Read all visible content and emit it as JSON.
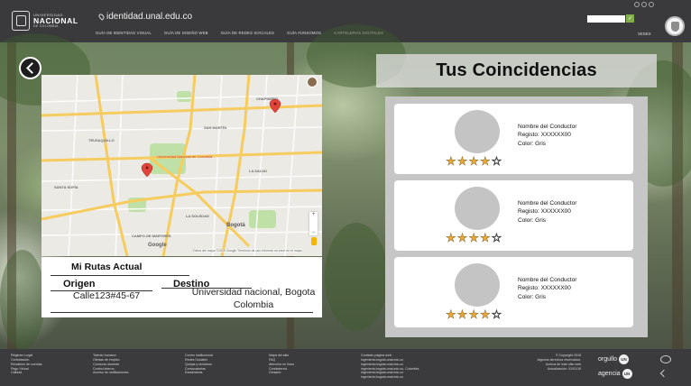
{
  "header": {
    "site_url": "identidad.unal.edu.co",
    "logo_small": "UNIVERSIDAD",
    "logo_big": "NACIONAL",
    "logo_sub": "DE COLOMBIA",
    "nav": [
      "GUÍA DE IDENTIDAD VISUAL",
      "GUÍA DE DISEÑO WEB",
      "GUÍA DE REDES SOCIALES",
      "GUÍA #UNSOMOS",
      "CARTELERAS DIGITALES"
    ],
    "sedes_label": "SEDES",
    "search_button_glyph": "✓"
  },
  "route": {
    "title": "Mi Rutas Actual",
    "origin_label": "Origen",
    "origin_value": "Calle123#45-67",
    "destination_label": "Destino",
    "destination_value": "Universidad nacional, Bogota Colombia"
  },
  "matches": {
    "title": "Tus Coincidencias",
    "drivers": [
      {
        "name": "Nombre del Conductor",
        "registro": "Registo: XXXXXX00",
        "color": "Color: Gris",
        "rating": 4,
        "max_rating": 5
      },
      {
        "name": "Nombre del Conductor",
        "registro": "Registo: XXXXXX00",
        "color": "Color: Gris",
        "rating": 4,
        "max_rating": 5
      },
      {
        "name": "Nombre del Conductor",
        "registro": "Registo: XXXXXX00",
        "color": "Color: Gris",
        "rating": 4,
        "max_rating": 5
      }
    ]
  },
  "map": {
    "place_label": "Universidad Nacional de Colombia",
    "city_label": "Bogotá",
    "google_label": "Google",
    "controls": [
      "+",
      "−"
    ],
    "footer_text": "Datos del mapa ©2019 Google  Términos de uso  Informar un error en el mapa",
    "zones": [
      "CHAPINERO",
      "TEUSAQUILLO",
      "LA SOLEDAD",
      "SANTA SOFÍA",
      "CAMPO DE MÁRTIRES",
      "LA SALUD",
      "SAN MARTÍN"
    ],
    "colors": {
      "road_major": "#f6cc5f",
      "road_minor": "#ffffff",
      "park": "#bfe1a7",
      "pin": "#e0453b"
    }
  },
  "footer": {
    "col1": [
      "Régimen Legal",
      "Contratación",
      "Rendición de cuentas",
      "Pago Virtual",
      "Calidad"
    ],
    "col2": [
      "Talento humano",
      "Ofertas de empleo",
      "Concurso docente",
      "Control interno",
      "Acceso de notificaciones"
    ],
    "col3": [
      "Correo institucional",
      "Redes Sociales",
      "Quejas y reclamos",
      "Convocatorias",
      "Estadísticas"
    ],
    "col4": [
      "Mapa del sitio",
      "FAQ",
      "Atención en línea",
      "Contáctenos",
      "Glosario"
    ],
    "col5": [
      "Contacto página web:",
      "ingenieria.bogota.unal.edu.co",
      "ingenieria.bogota.unal.edu.co",
      "ingenieria.bogota.unal.edu.co, Colombia",
      "ingenieria.bogota.unal.edu.co",
      "ingenieria.bogota.unal.edu.co"
    ],
    "col6": [
      "© Copyright 2018",
      "Algunos derechos reservados.",
      "Acerca de este sitio web",
      "Actualización: 01/01/18"
    ],
    "orgullo": "orgullo",
    "agencia": "agencia",
    "un_badge": "UN"
  }
}
